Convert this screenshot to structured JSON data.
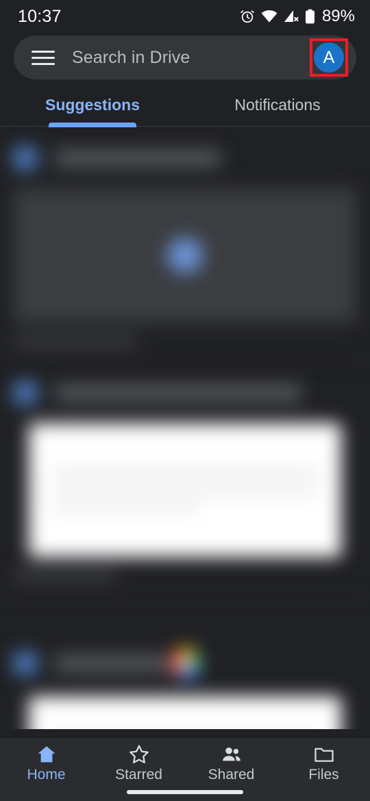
{
  "status_bar": {
    "time": "10:37",
    "battery_percent": "89%",
    "icons": [
      "alarm-icon",
      "wifi-icon",
      "cellular-no-sim-icon",
      "battery-icon"
    ]
  },
  "search": {
    "menu_icon": "hamburger-menu-icon",
    "placeholder": "Search in Drive",
    "avatar_letter": "A",
    "avatar_color": "#1a73c8",
    "highlight_color": "#ee1d24"
  },
  "tabs": [
    {
      "label": "Suggestions",
      "active": true
    },
    {
      "label": "Notifications",
      "active": false
    }
  ],
  "suggestions": [
    {
      "icon": "file-icon",
      "title": "",
      "subtitle": "",
      "thumbnail": "video-thumbnail",
      "overflow_icon": "more-vert-icon"
    },
    {
      "icon": "file-icon",
      "title": "",
      "subtitle": "",
      "thumbnail": "document-thumbnail",
      "overflow_icon": "more-vert-icon"
    },
    {
      "icon": "file-icon",
      "title": "",
      "subtitle": "",
      "thumbnail": "document-thumbnail",
      "trailing_icon": "chrome-icon"
    }
  ],
  "bottom_nav": [
    {
      "label": "Home",
      "icon": "home-icon",
      "active": true
    },
    {
      "label": "Starred",
      "icon": "star-icon",
      "active": false
    },
    {
      "label": "Shared",
      "icon": "people-icon",
      "active": false
    },
    {
      "label": "Files",
      "icon": "folder-icon",
      "active": false
    }
  ],
  "theme": {
    "background": "#202124",
    "surface": "#35363a",
    "accent": "#8ab4f8",
    "nav_background": "#2b2c2f"
  }
}
